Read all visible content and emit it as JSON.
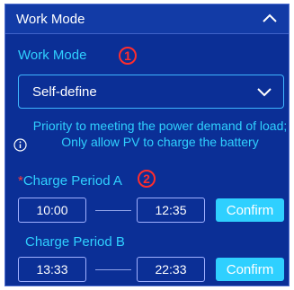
{
  "header": {
    "title": "Work Mode"
  },
  "work_mode": {
    "label": "Work Mode",
    "marker": "1",
    "selected": "Self-define",
    "info": "Priority to meeting the power demand of load; Only allow PV to charge the battery"
  },
  "period_a": {
    "required_mark": "*",
    "label": "Charge Period A",
    "marker": "2",
    "start": "10:00",
    "end": "12:35",
    "confirm": "Confirm"
  },
  "period_b": {
    "label": "Charge Period B",
    "start": "13:33",
    "end": "22:33",
    "confirm": "Confirm"
  },
  "colors": {
    "panel_bg": "#0b2f96",
    "accent": "#2fd0ff",
    "marker_red": "#ff2d2d"
  },
  "icons": [
    "chevron-up-icon",
    "chevron-down-icon",
    "info-icon"
  ]
}
